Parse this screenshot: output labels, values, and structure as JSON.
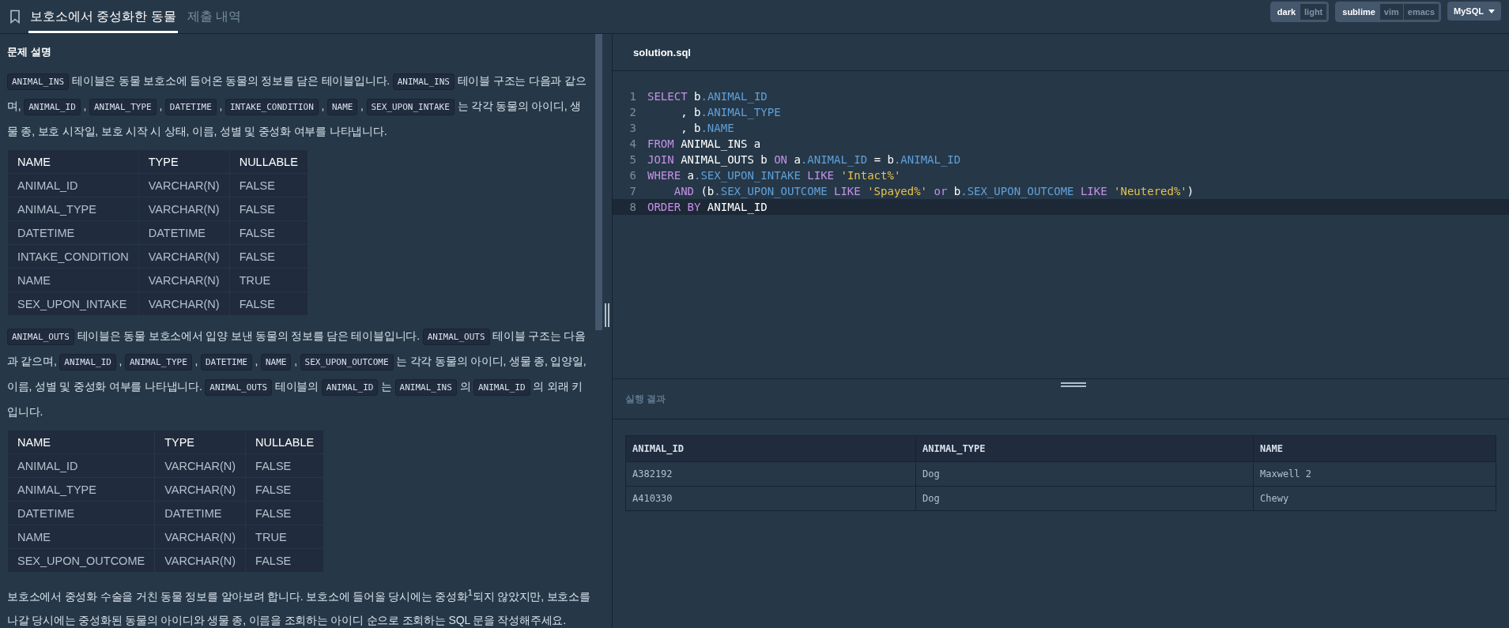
{
  "tabs": [
    {
      "label": "보호소에서 중성화한 동물",
      "selected": true
    },
    {
      "label": "제출 내역",
      "selected": false
    }
  ],
  "toolbar": {
    "themes": [
      {
        "label": "dark",
        "selected": true
      },
      {
        "label": "light",
        "selected": false
      }
    ],
    "keymaps": [
      {
        "label": "sublime",
        "selected": true
      },
      {
        "label": "vim",
        "selected": false
      },
      {
        "label": "emacs",
        "selected": false
      }
    ],
    "language": "MySQL"
  },
  "description": {
    "heading": "문제 설명",
    "blocks": [
      {
        "kind": "paragraph",
        "parts": [
          {
            "kind": "code",
            "text": "ANIMAL_INS"
          },
          {
            "kind": "text",
            "text": " 테이블은 동물 보호소에 들어온 동물의 정보를 담은 테이블입니다. "
          },
          {
            "kind": "code",
            "text": "ANIMAL_INS"
          },
          {
            "kind": "text",
            "text": " 테이블 구조는 다음과 같으며, "
          },
          {
            "kind": "code",
            "text": "ANIMAL_ID"
          },
          {
            "kind": "text",
            "text": " , "
          },
          {
            "kind": "code",
            "text": "ANIMAL_TYPE"
          },
          {
            "kind": "text",
            "text": " , "
          },
          {
            "kind": "code",
            "text": "DATETIME"
          },
          {
            "kind": "text",
            "text": " , "
          },
          {
            "kind": "code",
            "text": "INTAKE_CONDITION"
          },
          {
            "kind": "text",
            "text": " , "
          },
          {
            "kind": "code",
            "text": "NAME"
          },
          {
            "kind": "text",
            "text": " , "
          },
          {
            "kind": "code",
            "text": "SEX_UPON_INTAKE"
          },
          {
            "kind": "text",
            "text": " 는 각각 동물의 아이디, 생물 종, 보호 시작일, 보호 시작 시 상태, 이름, 성별 및 중성화 여부를 나타냅니다."
          }
        ]
      },
      {
        "kind": "table",
        "columns": [
          "NAME",
          "TYPE",
          "NULLABLE"
        ],
        "rows": [
          [
            "ANIMAL_ID",
            "VARCHAR(N)",
            "FALSE"
          ],
          [
            "ANIMAL_TYPE",
            "VARCHAR(N)",
            "FALSE"
          ],
          [
            "DATETIME",
            "DATETIME",
            "FALSE"
          ],
          [
            "INTAKE_CONDITION",
            "VARCHAR(N)",
            "FALSE"
          ],
          [
            "NAME",
            "VARCHAR(N)",
            "TRUE"
          ],
          [
            "SEX_UPON_INTAKE",
            "VARCHAR(N)",
            "FALSE"
          ]
        ]
      },
      {
        "kind": "paragraph",
        "parts": [
          {
            "kind": "code",
            "text": "ANIMAL_OUTS"
          },
          {
            "kind": "text",
            "text": " 테이블은 동물 보호소에서 입양 보낸 동물의 정보를 담은 테이블입니다. "
          },
          {
            "kind": "code",
            "text": "ANIMAL_OUTS"
          },
          {
            "kind": "text",
            "text": " 테이블 구조는 다음과 같으며, "
          },
          {
            "kind": "code",
            "text": "ANIMAL_ID"
          },
          {
            "kind": "text",
            "text": " , "
          },
          {
            "kind": "code",
            "text": "ANIMAL_TYPE"
          },
          {
            "kind": "text",
            "text": " , "
          },
          {
            "kind": "code",
            "text": "DATETIME"
          },
          {
            "kind": "text",
            "text": " , "
          },
          {
            "kind": "code",
            "text": "NAME"
          },
          {
            "kind": "text",
            "text": " , "
          },
          {
            "kind": "code",
            "text": "SEX_UPON_OUTCOME"
          },
          {
            "kind": "text",
            "text": " 는 각각 동물의 아이디, 생물 종, 입양일, 이름, 성별 및 중성화 여부를 나타냅니다. "
          },
          {
            "kind": "code",
            "text": "ANIMAL_OUTS"
          },
          {
            "kind": "text",
            "text": " 테이블의 "
          },
          {
            "kind": "code",
            "text": "ANIMAL_ID"
          },
          {
            "kind": "text",
            "text": " 는 "
          },
          {
            "kind": "code",
            "text": "ANIMAL_INS"
          },
          {
            "kind": "text",
            "text": " 의 "
          },
          {
            "kind": "code",
            "text": "ANIMAL_ID"
          },
          {
            "kind": "text",
            "text": " 의 외래 키입니다."
          }
        ]
      },
      {
        "kind": "table",
        "columns": [
          "NAME",
          "TYPE",
          "NULLABLE"
        ],
        "rows": [
          [
            "ANIMAL_ID",
            "VARCHAR(N)",
            "FALSE"
          ],
          [
            "ANIMAL_TYPE",
            "VARCHAR(N)",
            "FALSE"
          ],
          [
            "DATETIME",
            "DATETIME",
            "FALSE"
          ],
          [
            "NAME",
            "VARCHAR(N)",
            "TRUE"
          ],
          [
            "SEX_UPON_OUTCOME",
            "VARCHAR(N)",
            "FALSE"
          ]
        ]
      },
      {
        "kind": "paragraph",
        "parts": [
          {
            "kind": "text",
            "text": "보호소에서 중성화 수술을 거친 동물 정보를 알아보려 합니다. 보호소에 들어올 당시에는 중성화$^{1}$되지 않았지만, 보호소를 나갈 당시에는 중성화된 동물의 아이디와 생물 종, 이름을 조회하는 아이디 순으로 조회하는 SQL 문을 작성해주세요."
          }
        ]
      }
    ]
  },
  "editor": {
    "filename": "solution.sql",
    "lines": [
      {
        "number": "1",
        "active": false,
        "tokens": [
          {
            "kind": "keyword",
            "text": "SELECT "
          },
          {
            "kind": "plain",
            "text": "b"
          },
          {
            "kind": "field",
            "text": ".ANIMAL_ID"
          }
        ]
      },
      {
        "number": "2",
        "active": false,
        "tokens": [
          {
            "kind": "plain",
            "text": "     , b"
          },
          {
            "kind": "field",
            "text": ".ANIMAL_TYPE"
          }
        ]
      },
      {
        "number": "3",
        "active": false,
        "tokens": [
          {
            "kind": "plain",
            "text": "     , b"
          },
          {
            "kind": "field",
            "text": ".NAME"
          }
        ]
      },
      {
        "number": "4",
        "active": false,
        "tokens": [
          {
            "kind": "keyword",
            "text": "FROM "
          },
          {
            "kind": "plain",
            "text": "ANIMAL_INS a"
          }
        ]
      },
      {
        "number": "5",
        "active": false,
        "tokens": [
          {
            "kind": "keyword",
            "text": "JOIN "
          },
          {
            "kind": "plain",
            "text": "ANIMAL_OUTS b "
          },
          {
            "kind": "keyword",
            "text": "ON "
          },
          {
            "kind": "plain",
            "text": "a"
          },
          {
            "kind": "field",
            "text": ".ANIMAL_ID"
          },
          {
            "kind": "plain",
            "text": " = b"
          },
          {
            "kind": "field",
            "text": ".ANIMAL_ID"
          }
        ]
      },
      {
        "number": "6",
        "active": false,
        "tokens": [
          {
            "kind": "keyword",
            "text": "WHERE "
          },
          {
            "kind": "plain",
            "text": "a"
          },
          {
            "kind": "field",
            "text": ".SEX_UPON_INTAKE "
          },
          {
            "kind": "keyword",
            "text": "LIKE "
          },
          {
            "kind": "string",
            "text": "'Intact%'"
          }
        ]
      },
      {
        "number": "7",
        "active": false,
        "tokens": [
          {
            "kind": "keyword",
            "text": "    AND "
          },
          {
            "kind": "plain",
            "text": "(b"
          },
          {
            "kind": "field",
            "text": ".SEX_UPON_OUTCOME "
          },
          {
            "kind": "keyword",
            "text": "LIKE "
          },
          {
            "kind": "string",
            "text": "'Spayed%' "
          },
          {
            "kind": "keyword",
            "text": "or "
          },
          {
            "kind": "plain",
            "text": "b"
          },
          {
            "kind": "field",
            "text": ".SEX_UPON_OUTCOME "
          },
          {
            "kind": "keyword",
            "text": "LIKE "
          },
          {
            "kind": "string",
            "text": "'Neutered%'"
          },
          {
            "kind": "plain",
            "text": ")"
          }
        ]
      },
      {
        "number": "8",
        "active": true,
        "tokens": [
          {
            "kind": "keyword",
            "text": "ORDER BY "
          },
          {
            "kind": "plain",
            "text": "ANIMAL_ID"
          }
        ]
      }
    ]
  },
  "results": {
    "heading": "실행 결과",
    "columns": [
      "ANIMAL_ID",
      "ANIMAL_TYPE",
      "NAME"
    ],
    "rows": [
      [
        "A382192",
        "Dog",
        "Maxwell 2"
      ],
      [
        "A410330",
        "Dog",
        "Chewy"
      ]
    ]
  }
}
